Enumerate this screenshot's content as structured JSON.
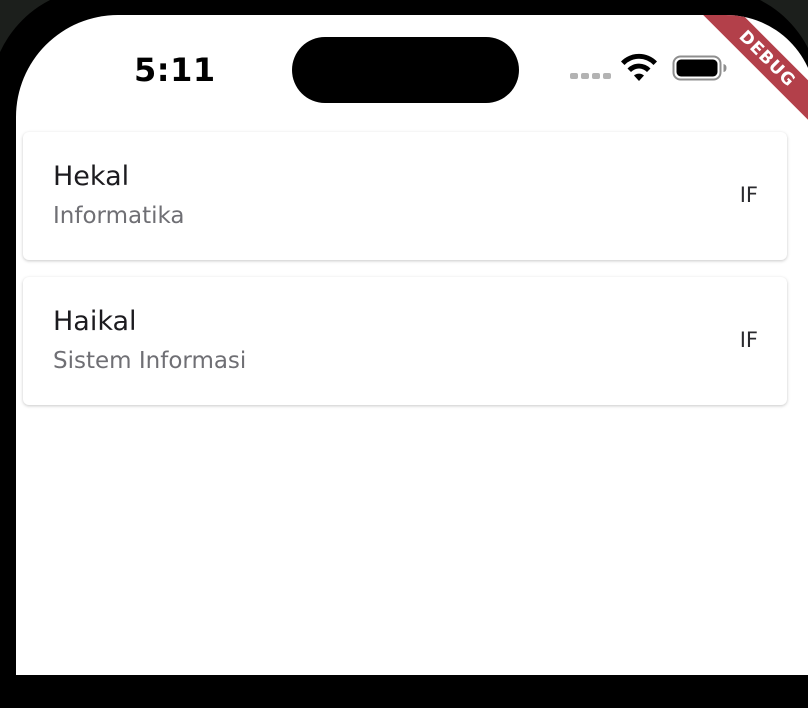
{
  "status_bar": {
    "time": "5:11",
    "signal_icon": "signal-dots-icon",
    "wifi_icon": "wifi-icon",
    "battery_icon": "battery-icon"
  },
  "debug_banner": {
    "label": "DEBUG",
    "color": "#b3404a"
  },
  "list": {
    "items": [
      {
        "title": "Hekal",
        "subtitle": "Informatika",
        "trailing": "IF"
      },
      {
        "title": "Haikal",
        "subtitle": "Sistem Informasi",
        "trailing": "IF"
      }
    ]
  }
}
